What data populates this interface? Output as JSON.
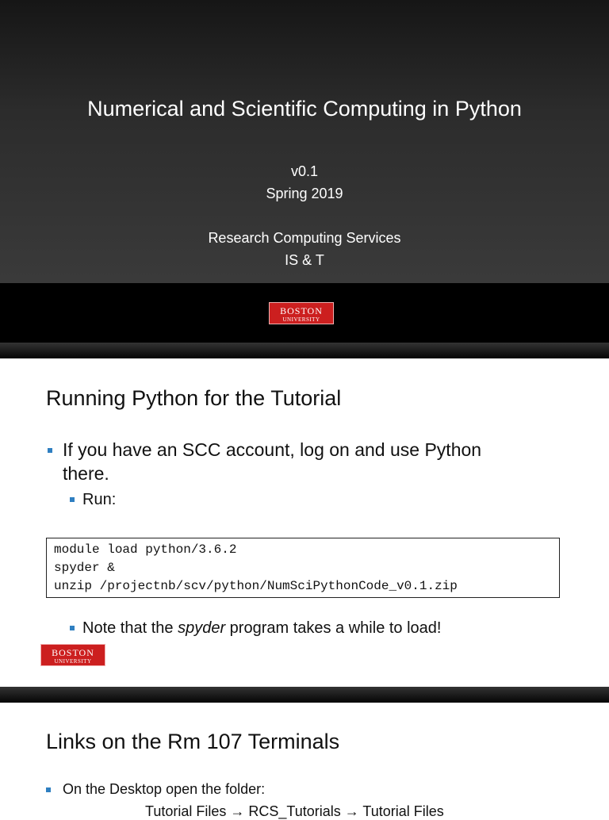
{
  "slide1": {
    "title": "Numerical and Scientific Computing in Python",
    "version": "v0.1",
    "term": "Spring 2019",
    "org": "Research Computing Services",
    "dept": "IS & T"
  },
  "logo": {
    "line1": "BOSTON",
    "line2": "UNIVERSITY"
  },
  "slide2": {
    "title": "Running Python for the Tutorial",
    "bullet1": "If you have an SCC account, log on and use Python",
    "bullet1b": "there.",
    "sub1": "Run:",
    "code": [
      "module load python/3.6.2",
      "spyder &",
      "unzip /projectnb/scv/python/NumSciPythonCode_v0.1.zip"
    ],
    "note_pre": "Note that the ",
    "note_em": "spyder",
    "note_post": " program takes a while to load!"
  },
  "slide3": {
    "title": "Links on the Rm 107 Terminals",
    "bullet1": "On the Desktop open the folder:",
    "path": "Tutorial Files → RCS_Tutorials → Tutorial Files"
  },
  "colors": {
    "bullet": "#2f7fc1",
    "logo": "#cc1f1f"
  }
}
